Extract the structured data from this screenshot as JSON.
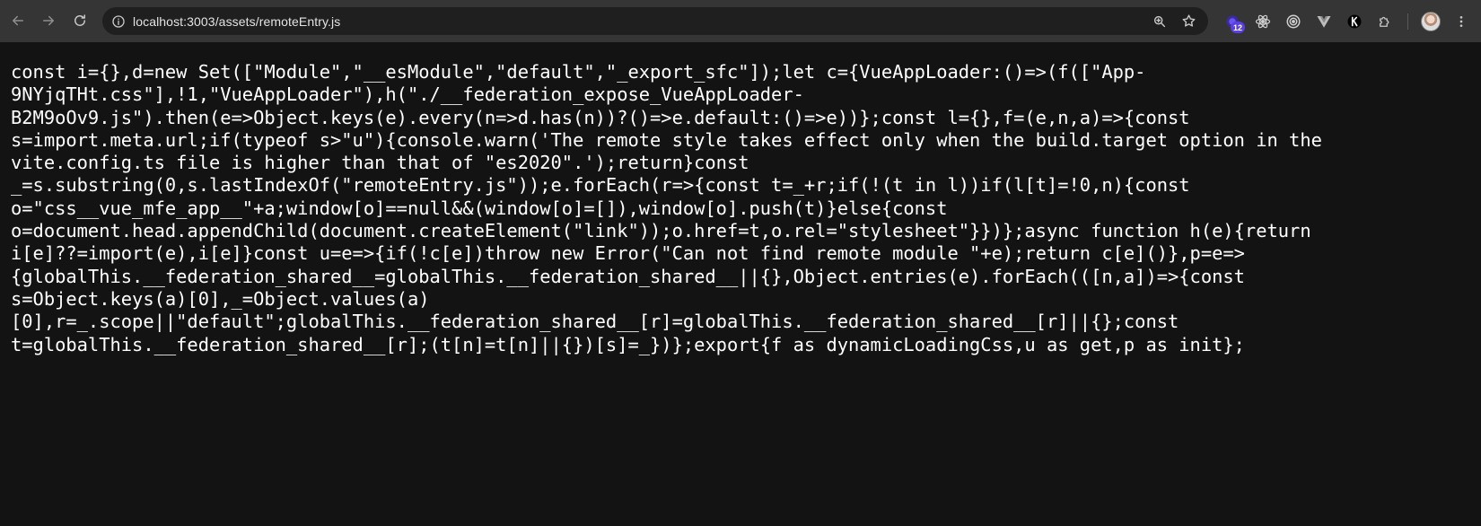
{
  "toolbar": {
    "back_icon": "arrow-back-icon",
    "forward_icon": "arrow-forward-icon",
    "reload_icon": "reload-icon",
    "url": "localhost:3003/assets/remoteEntry.js",
    "site_info_icon": "info-icon",
    "zoom_icon": "zoom-icon",
    "bookmark_icon": "star-icon",
    "extensions": [
      {
        "icon": "extension-badge-icon",
        "badge": "12"
      },
      {
        "icon": "react-icon"
      },
      {
        "icon": "target-icon"
      },
      {
        "icon": "vue-icon"
      },
      {
        "icon": "k-icon"
      },
      {
        "icon": "puzzle-icon"
      }
    ],
    "menu_icon": "kebab-menu-icon"
  },
  "content": {
    "code_lines": [
      "const i={},d=new Set([\"Module\",\"__esModule\",\"default\",\"_export_sfc\"]);let c={VueAppLoader:()=>(f([\"App-",
      "9NYjqTHt.css\"],!1,\"VueAppLoader\"),h(\"./__federation_expose_VueAppLoader-",
      "B2M9oOv9.js\").then(e=>Object.keys(e).every(n=>d.has(n))?()=>e.default:()=>e))};const l={},f=(e,n,a)=>{const",
      "s=import.meta.url;if(typeof s>\"u\"){console.warn('The remote style takes effect only when the build.target option in the",
      "vite.config.ts file is higher than that of \"es2020\".');return}const",
      "_=s.substring(0,s.lastIndexOf(\"remoteEntry.js\"));e.forEach(r=>{const t=_+r;if(!(t in l))if(l[t]=!0,n){const",
      "o=\"css__vue_mfe_app__\"+a;window[o]==null&&(window[o]=[]),window[o].push(t)}else{const",
      "o=document.head.appendChild(document.createElement(\"link\"));o.href=t,o.rel=\"stylesheet\"}})};async function h(e){return",
      "i[e]??=import(e),i[e]}const u=e=>{if(!c[e])throw new Error(\"Can not find remote module \"+e);return c[e]()},p=e=>",
      "{globalThis.__federation_shared__=globalThis.__federation_shared__||{},Object.entries(e).forEach(([n,a])=>{const",
      "s=Object.keys(a)[0],_=Object.values(a)",
      "[0],r=_.scope||\"default\";globalThis.__federation_shared__[r]=globalThis.__federation_shared__[r]||{};const",
      "t=globalThis.__federation_shared__[r];(t[n]=t[n]||{})[s]=_})};export{f as dynamicLoadingCss,u as get,p as init};"
    ]
  }
}
